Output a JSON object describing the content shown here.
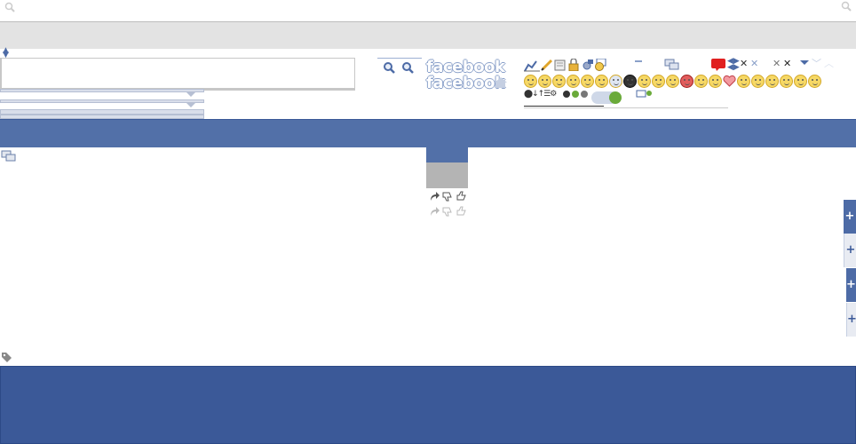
{
  "logo": {
    "text": "facebook"
  },
  "logo2": {
    "text": "facebook"
  },
  "colors": {
    "fb_blue": "#3b5998",
    "fb_blue_light": "#5270a8",
    "gray_bar": "#e3e3e3",
    "notify_red": "#e02020"
  },
  "icons": {
    "top_left": "search-icon",
    "top_right": "search-icon",
    "tag": "tag-icon",
    "chat": "chat-bubbles-icon",
    "share": "share-icon",
    "dislike": "thumbs-down-icon",
    "like": "thumbs-up-icon",
    "plus": "plus-icon",
    "home": "home-icon"
  },
  "plus_tabs": [
    "+",
    "+",
    "+",
    "+"
  ]
}
